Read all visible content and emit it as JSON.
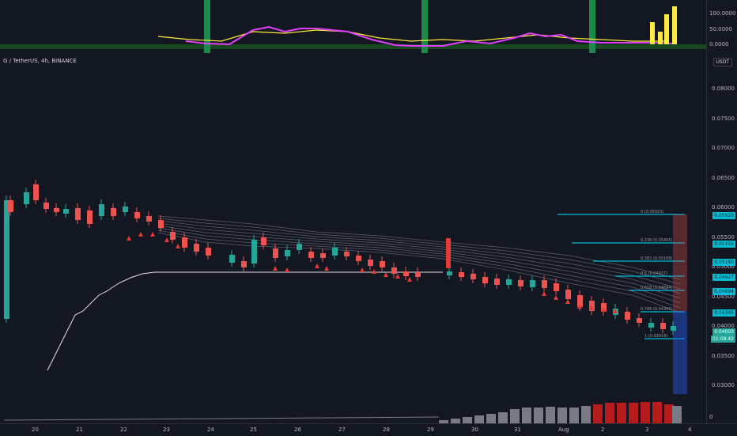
{
  "symbol": "G / TetherUS, 4h, BINANCE",
  "quote_currency": "USDT",
  "osc_axis": [
    "100.0000",
    "50.0000",
    "0.0000"
  ],
  "price_axis": [
    "0.08000",
    "0.07500",
    "0.07000",
    "0.06500",
    "0.06000",
    "0.05500",
    "0.05000",
    "0.04500",
    "0.04000",
    "0.03500",
    "0.03000"
  ],
  "fib_labels": [
    "0 (0.05920)",
    "0.236 (0.05455)",
    "0.382 (0.05168)",
    "0.5 (0.04927)",
    "0.618 (0.04694)",
    "0.786 (0.04345)",
    "1 (0.03918)"
  ],
  "fib_boxes": [
    "0.05920",
    "0.05455",
    "0.05160",
    "0.04927",
    "0.04694",
    "0.04345"
  ],
  "last_price": "0.04003",
  "countdown": "01:08:42",
  "vol_axis": "0",
  "dates": [
    "20",
    "21",
    "22",
    "23",
    "24",
    "25",
    "26",
    "27",
    "28",
    "29",
    "30",
    "31",
    "Aug",
    "2",
    "3",
    "4"
  ],
  "td_counts_down": [
    "1",
    "2",
    "3",
    "4",
    "5",
    "6",
    "7",
    "8",
    "9"
  ],
  "colors": {
    "up": "#26a69a",
    "down": "#ef5350",
    "fib": "#00bcd4",
    "osc": "#e040fb",
    "signal": "#ffeb3b",
    "green_bar": "#1b8a4a"
  }
}
